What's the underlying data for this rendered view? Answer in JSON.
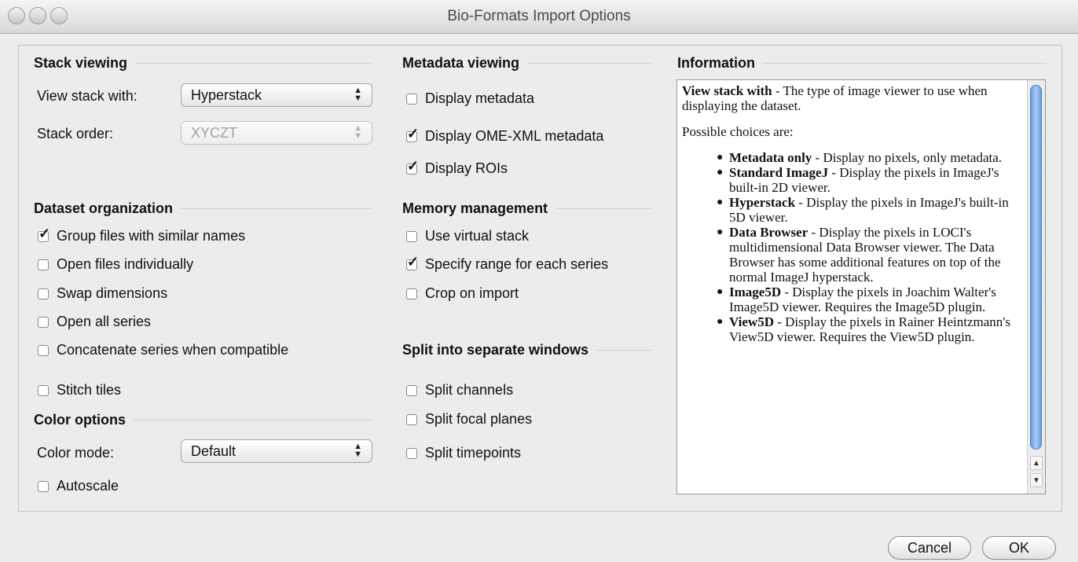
{
  "window": {
    "title": "Bio-Formats Import Options"
  },
  "stack_viewing": {
    "heading": "Stack viewing",
    "view_stack_label": "View stack with:",
    "view_stack_value": "Hyperstack",
    "stack_order_label": "Stack order:",
    "stack_order_value": "XYCZT"
  },
  "dataset_organization": {
    "heading": "Dataset organization",
    "options": [
      {
        "label": "Group files with similar names",
        "checked": true
      },
      {
        "label": "Open files individually",
        "checked": false
      },
      {
        "label": "Swap dimensions",
        "checked": false
      },
      {
        "label": "Open all series",
        "checked": false
      },
      {
        "label": "Concatenate series when compatible",
        "checked": false
      },
      {
        "label": "Stitch tiles",
        "checked": false
      }
    ]
  },
  "color_options": {
    "heading": "Color options",
    "color_mode_label": "Color mode:",
    "color_mode_value": "Default",
    "autoscale": {
      "label": "Autoscale",
      "checked": false
    }
  },
  "metadata_viewing": {
    "heading": "Metadata viewing",
    "options": [
      {
        "label": "Display metadata",
        "checked": false
      },
      {
        "label": "Display OME-XML metadata",
        "checked": true
      },
      {
        "label": "Display ROIs",
        "checked": true
      }
    ]
  },
  "memory_management": {
    "heading": "Memory management",
    "options": [
      {
        "label": "Use virtual stack",
        "checked": false
      },
      {
        "label": "Specify range for each series",
        "checked": true
      },
      {
        "label": "Crop on import",
        "checked": false
      }
    ]
  },
  "split_windows": {
    "heading": "Split into separate windows",
    "options": [
      {
        "label": "Split channels",
        "checked": false
      },
      {
        "label": "Split focal planes",
        "checked": false
      },
      {
        "label": "Split timepoints",
        "checked": false
      }
    ]
  },
  "information": {
    "heading": "Information",
    "intro_bold": "View stack with",
    "intro_rest": " - The type of image viewer to use when displaying the dataset.",
    "choices_intro": "Possible choices are:",
    "choices": [
      {
        "name": "Metadata only",
        "desc": " - Display no pixels, only metadata."
      },
      {
        "name": "Standard ImageJ",
        "desc": " - Display the pixels in ImageJ's built-in 2D viewer."
      },
      {
        "name": "Hyperstack",
        "desc": " - Display the pixels in ImageJ's built-in 5D viewer."
      },
      {
        "name": "Data Browser",
        "desc": " - Display the pixels in LOCI's multidimensional Data Browser viewer. The Data Browser has some additional features on top of the normal ImageJ hyperstack."
      },
      {
        "name": "Image5D",
        "desc": " - Display the pixels in Joachim Walter's Image5D viewer. Requires the Image5D plugin."
      },
      {
        "name": "View5D",
        "desc": " - Display the pixels in Rainer Heintzmann's View5D viewer. Requires the View5D plugin."
      }
    ]
  },
  "buttons": {
    "cancel": "Cancel",
    "ok": "OK"
  },
  "check_glyph": "✓",
  "bullet_glyph": "●"
}
